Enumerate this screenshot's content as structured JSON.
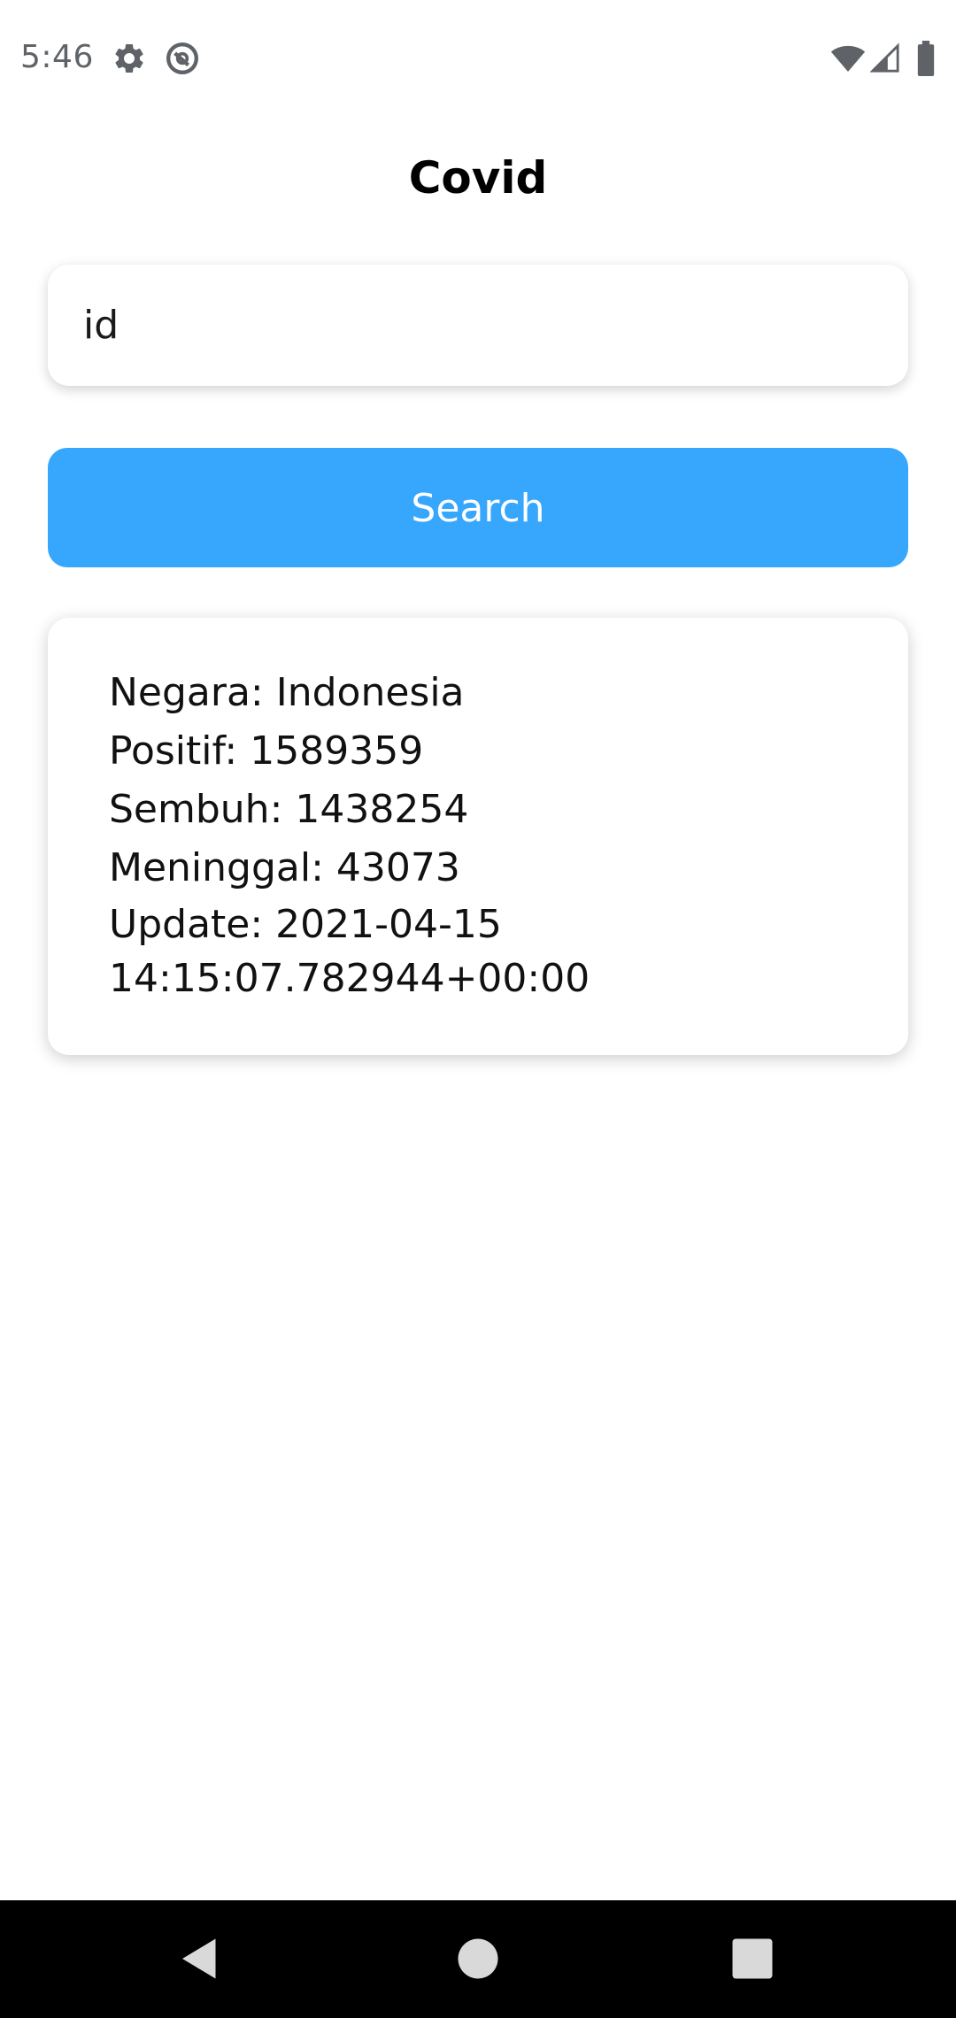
{
  "status_bar": {
    "time": "5:46",
    "icons": [
      "gear-icon",
      "do-not-disturb-icon",
      "wifi-icon",
      "cellular-signal-icon",
      "battery-icon"
    ]
  },
  "header": {
    "title": "Covid"
  },
  "search": {
    "value": "id",
    "button_label": "Search"
  },
  "result": {
    "lines": [
      "Negara: Indonesia",
      "Positif: 1589359",
      "Sembuh: 1438254",
      "Meninggal: 43073",
      "Update: 2021-04-15 14:15:07.782944+00:00"
    ]
  },
  "nav_bar": {
    "icons": [
      "back-icon",
      "home-icon",
      "recents-icon"
    ]
  },
  "colors": {
    "accent": "#37a6fd",
    "background": "#ffffff",
    "nav_bar": "#000000"
  }
}
